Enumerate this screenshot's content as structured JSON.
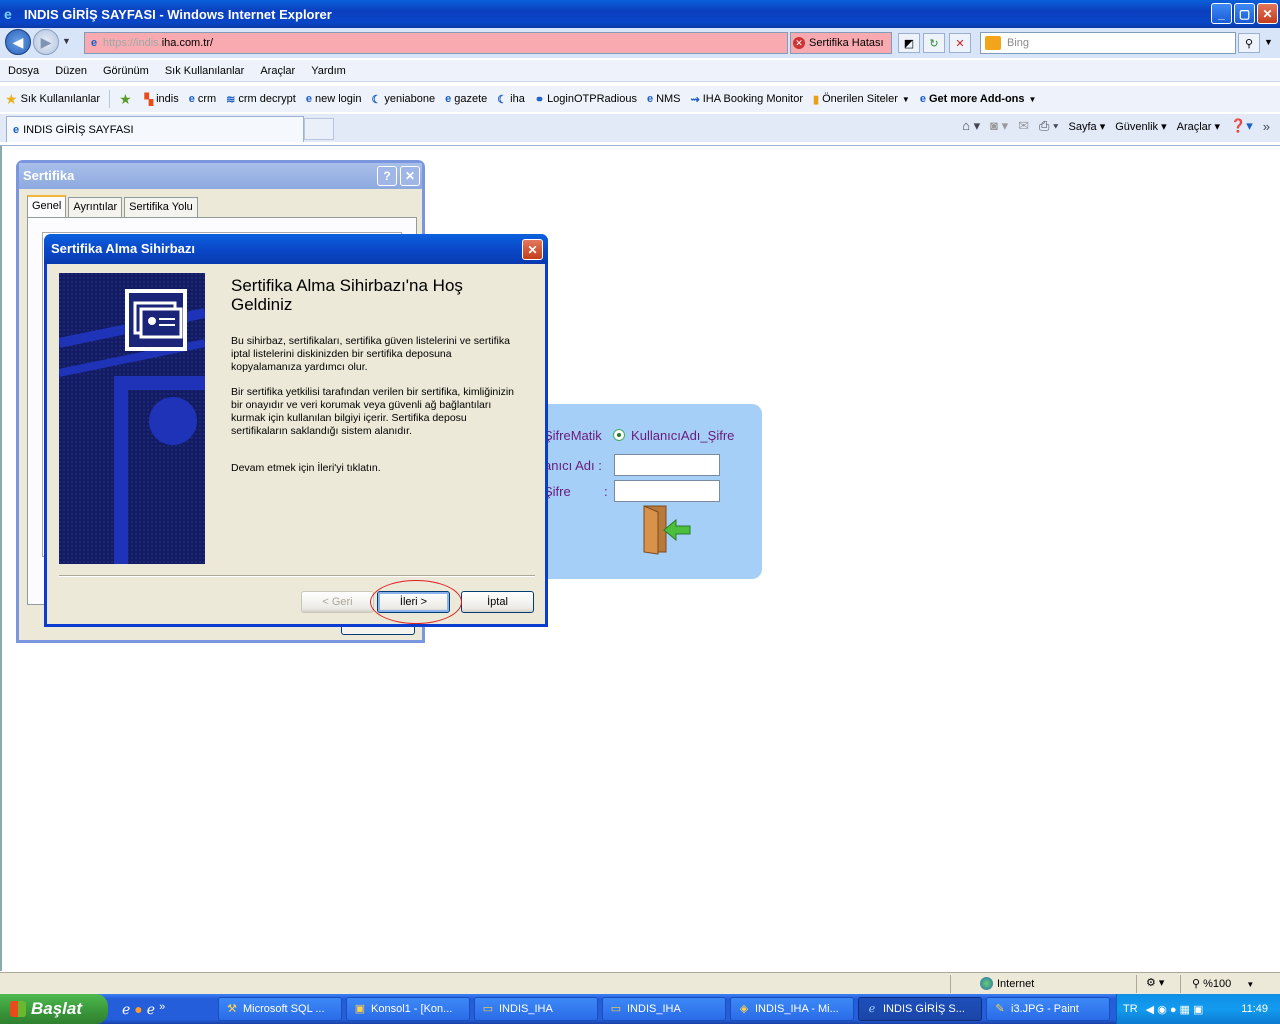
{
  "window": {
    "title": "INDIS GİRİŞ SAYFASI - Windows Internet Explorer",
    "minimize": "_",
    "maximize": "▢",
    "close": "✕"
  },
  "address": {
    "url_prefix": "https://indis.",
    "url_domain": "iha.com.tr/",
    "cert_error": "Sertifika Hatası",
    "search_placeholder": "Bing"
  },
  "menu": [
    "Dosya",
    "Düzen",
    "Görünüm",
    "Sık Kullanılanlar",
    "Araçlar",
    "Yardım"
  ],
  "favorites": {
    "main": "Sık Kullanılanlar",
    "items": [
      "indis",
      "crm",
      "crm decrypt",
      "new login",
      "yeniabone",
      "gazete",
      "iha",
      "LoginOTPRadious",
      "NMS",
      "IHA Booking Monitor",
      "Önerilen Siteler",
      "Get more Add-ons"
    ]
  },
  "tab": {
    "title": "INDIS GİRİŞ SAYFASI"
  },
  "command_bar": [
    "Sayfa",
    "Güvenlik",
    "Araçlar"
  ],
  "cert_dialog": {
    "title": "Sertifika",
    "help": "?",
    "close": "✕",
    "tabs": [
      "Genel",
      "Ayrıntılar",
      "Sertifika Yolu"
    ]
  },
  "wizard": {
    "title": "Sertifika Alma Sihirbazı",
    "close": "✕",
    "heading": "Sertifika Alma Sihirbazı'na Hoş Geldiniz",
    "para1": "Bu sihirbaz, sertifikaları, sertifika güven listelerini ve sertifika iptal listelerini diskinizden bir sertifika deposuna kopyalamanıza yardımcı olur.",
    "para2": "Bir sertifika yetkilisi tarafından verilen bir sertifika, kimliğinizin bir onayıdır ve veri korumak veya güvenli ağ bağlantıları kurmak için kullanılan bilgiyi içerir. Sertifika deposu sertifikaların saklandığı sistem alanıdır.",
    "para3": "Devam etmek için İleri'yi tıklatın.",
    "back_button": "< Geri",
    "next_button": "İleri >",
    "cancel_button": "İptal"
  },
  "login": {
    "option1": "ŞifreMatik",
    "option2": "KullanıcıAdı_Şifre",
    "username_label": "anıcı Adı :",
    "password_label": "Şifre",
    "password_colon": ":"
  },
  "status": {
    "zone": "Internet",
    "zoom": "%100"
  },
  "taskbar": {
    "start": "Başlat",
    "items": [
      "Microsoft SQL ...",
      "Konsol1 - [Kon...",
      "INDIS_IHA",
      "INDIS_IHA",
      "INDIS_IHA - Mi...",
      "INDIS GİRİŞ S...",
      "i3.JPG - Paint"
    ],
    "lang": "TR",
    "clock": "11:49"
  }
}
